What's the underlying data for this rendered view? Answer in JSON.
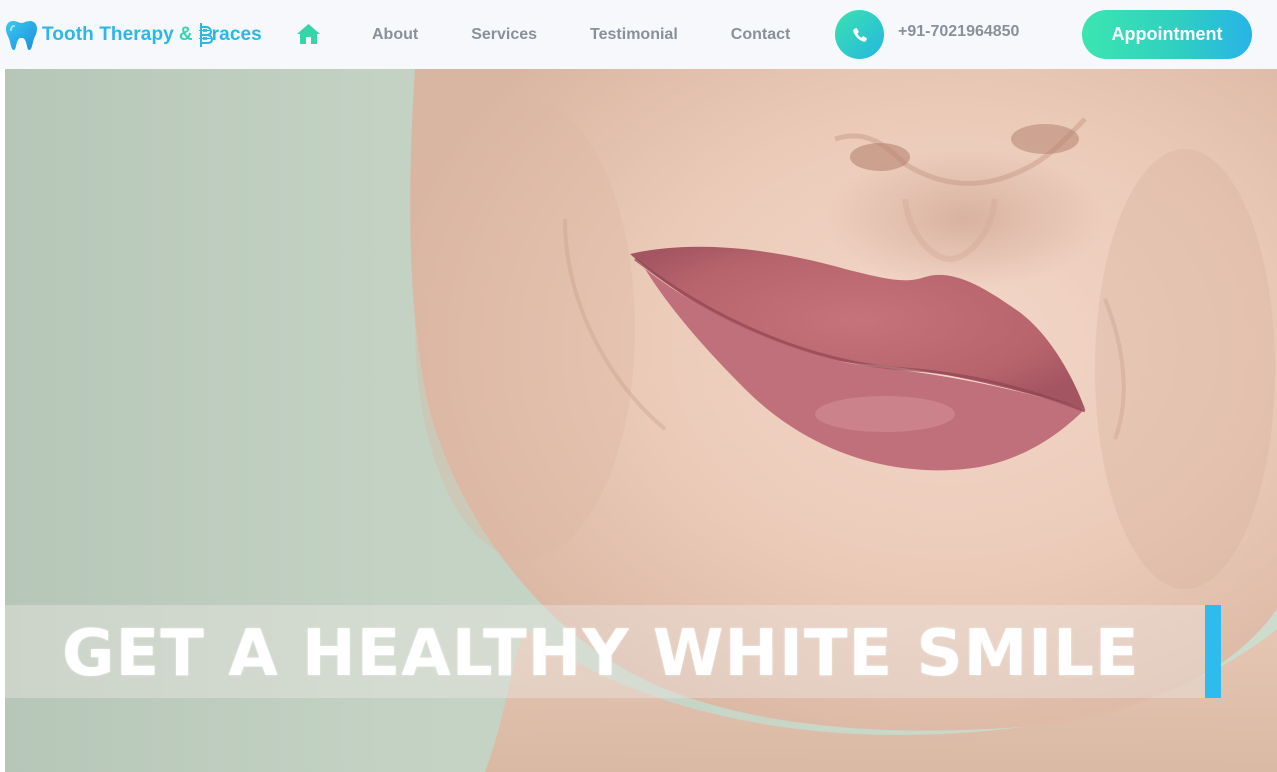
{
  "brand": {
    "name_part1": "Tooth Therapy",
    "ampersand": "&",
    "name_part2": "races",
    "colors": {
      "primary": "#2cb6e9",
      "accent": "#35d5b4"
    },
    "icons": [
      "tooth-icon",
      "braces-b-icon"
    ]
  },
  "nav": {
    "home_icon": "home-icon",
    "links": [
      {
        "label": "About"
      },
      {
        "label": "Services"
      },
      {
        "label": "Testimonial"
      },
      {
        "label": "Contact"
      }
    ]
  },
  "contact": {
    "phone_icon": "phone-icon",
    "phone": "+91-7021964850"
  },
  "cta": {
    "appointment_label": "Appointment",
    "gradient": [
      "#3ae6b0",
      "#27b4e8"
    ]
  },
  "hero": {
    "caption": "GET A HEALTHY WHITE SMILE",
    "cursor_color": "#2ebbee"
  }
}
